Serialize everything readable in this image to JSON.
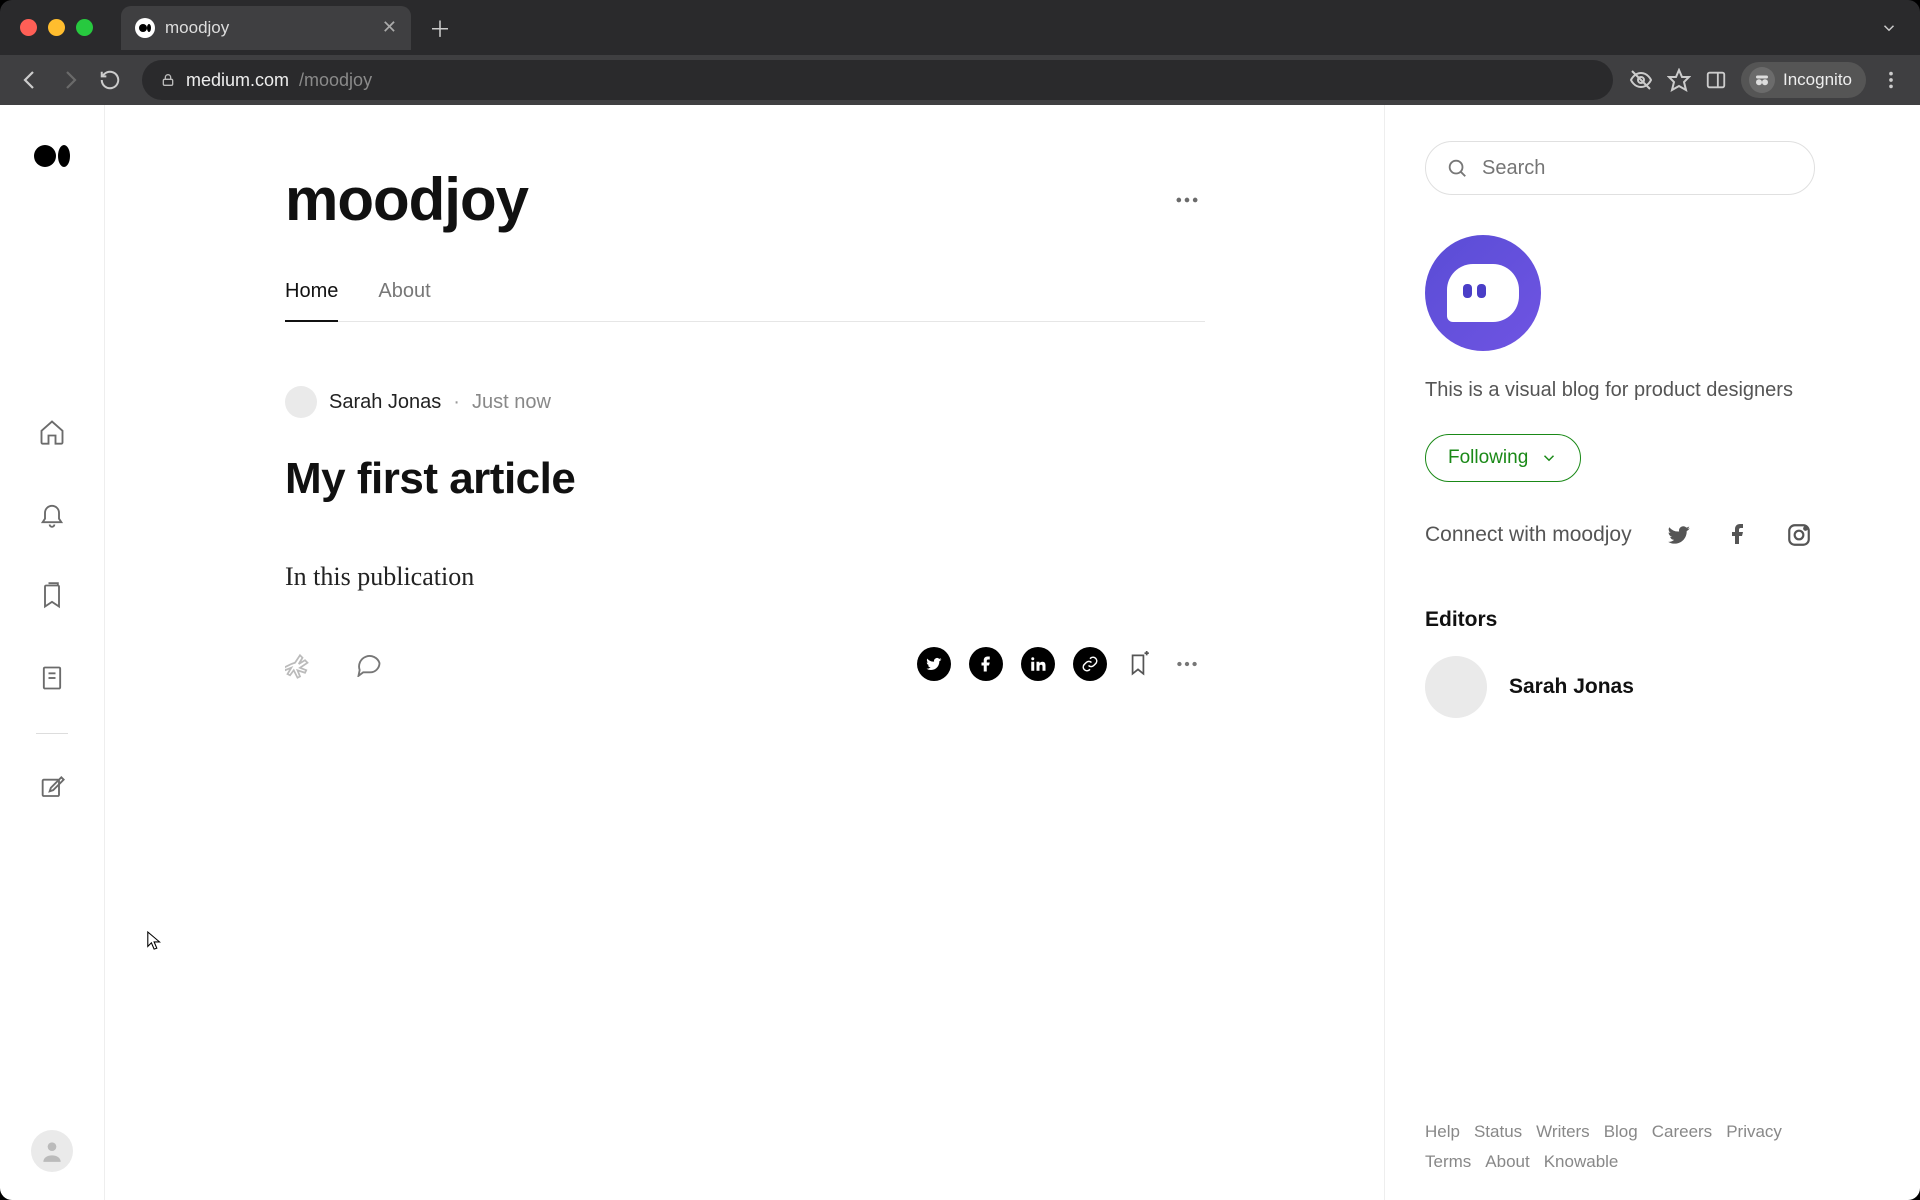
{
  "browser": {
    "tab_title": "moodjoy",
    "url_host": "medium.com",
    "url_path": "/moodjoy",
    "incognito_label": "Incognito"
  },
  "publication": {
    "title": "moodjoy",
    "tabs": [
      {
        "label": "Home",
        "active": true
      },
      {
        "label": "About",
        "active": false
      }
    ],
    "description": "This is a visual blog for product designers",
    "follow_label": "Following",
    "connect_label": "Connect with moodjoy"
  },
  "article": {
    "author": "Sarah Jonas",
    "time": "Just now",
    "title": "My first article",
    "excerpt": "In this publication"
  },
  "sidebar": {
    "search_placeholder": "Search",
    "editors_heading": "Editors",
    "editors": [
      {
        "name": "Sarah Jonas"
      }
    ]
  },
  "footer": {
    "links": [
      "Help",
      "Status",
      "Writers",
      "Blog",
      "Careers",
      "Privacy",
      "Terms",
      "About",
      "Knowable"
    ]
  }
}
